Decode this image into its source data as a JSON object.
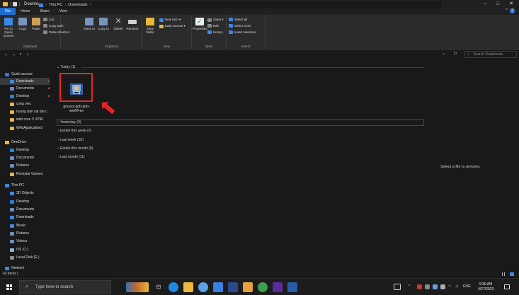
{
  "window": {
    "title": "Downloads",
    "controls": {
      "minimize": "–",
      "maximize": "□",
      "close": "✕"
    }
  },
  "ribbon_tabs": [
    "File",
    "Home",
    "Share",
    "View"
  ],
  "ribbon": {
    "clipboard": {
      "pin_to_quick_access": "Pin to Quick access",
      "copy": "Copy",
      "paste": "Paste",
      "cut": "Cut",
      "copy_path": "Copy path",
      "paste_shortcut": "Paste shortcut",
      "label": "Clipboard"
    },
    "organize": {
      "move_to": "Move to",
      "copy_to": "Copy to",
      "delete": "Delete",
      "rename": "Rename",
      "label": "Organize"
    },
    "new": {
      "new_folder": "New folder",
      "new_item": "New item ▾",
      "easy_access": "Easy access ▾",
      "label": "New"
    },
    "open": {
      "properties": "Properties",
      "open": "Open ▾",
      "edit": "Edit",
      "history": "History",
      "label": "Open"
    },
    "select": {
      "select_all": "Select all",
      "select_none": "Select none",
      "invert_selection": "Invert selection",
      "label": "Select"
    }
  },
  "address": {
    "crumb_root": "This PC",
    "crumb_current": "Downloads",
    "search_placeholder": "Search Downloads"
  },
  "nav_pane": {
    "items": [
      {
        "label": "Quick access",
        "icon": "star-icon",
        "color": "#2e7fe0"
      },
      {
        "label": "Downloads",
        "icon": "download-folder-icon",
        "color": "#3a89e6",
        "pinned": true,
        "selected": true
      },
      {
        "label": "Documents",
        "icon": "documents-icon",
        "color": "#6b8fc4",
        "pinned": true
      },
      {
        "label": "Desktop",
        "icon": "desktop-icon",
        "color": "#1e88e5",
        "pinned": true
      },
      {
        "label": "cong viec",
        "icon": "folder-icon",
        "color": "#e8b93c"
      },
      {
        "label": "huong dan cai dat c",
        "icon": "folder-icon",
        "color": "#e8b93c"
      },
      {
        "label": "intel core i7 4790",
        "icon": "folder-icon",
        "color": "#e8b93c"
      },
      {
        "label": "WebApplication1",
        "icon": "folder-icon",
        "color": "#e8b93c"
      },
      {
        "label": "OneDrive",
        "icon": "onedrive-icon",
        "color": "#e8b93c"
      },
      {
        "label": "Desktop",
        "icon": "desktop-icon",
        "color": "#1e88e5"
      },
      {
        "label": "Documents",
        "icon": "documents-icon",
        "color": "#6b8fc4"
      },
      {
        "label": "Pictures",
        "icon": "pictures-icon",
        "color": "#6b8fc4"
      },
      {
        "label": "Rockstar Games",
        "icon": "folder-icon",
        "color": "#e8b93c"
      },
      {
        "label": "This PC",
        "icon": "pc-icon",
        "color": "#3a89e6"
      },
      {
        "label": "3D Objects",
        "icon": "3d-objects-icon",
        "color": "#3a89e6"
      },
      {
        "label": "Desktop",
        "icon": "desktop-icon",
        "color": "#1e88e5"
      },
      {
        "label": "Documents",
        "icon": "documents-icon",
        "color": "#6b8fc4"
      },
      {
        "label": "Downloads",
        "icon": "download-icon",
        "color": "#3a89e6"
      },
      {
        "label": "Music",
        "icon": "music-icon",
        "color": "#3a89e6"
      },
      {
        "label": "Pictures",
        "icon": "pictures-icon",
        "color": "#6b8fc4"
      },
      {
        "label": "Videos",
        "icon": "videos-icon",
        "color": "#6b8fc4"
      },
      {
        "label": "OS (C:)",
        "icon": "drive-icon",
        "color": "#8fb3d9"
      },
      {
        "label": "Local Disk (E:)",
        "icon": "drive-icon",
        "color": "#8f8f8f"
      },
      {
        "label": "Network",
        "icon": "network-icon",
        "color": "#3a89e6"
      }
    ]
  },
  "content": {
    "groups": [
      {
        "label": "Today (1)",
        "expanded": true
      },
      {
        "label": "Yesterday (3)"
      },
      {
        "label": "Earlier this week (2)"
      },
      {
        "label": "Last week (18)"
      },
      {
        "label": "Earlier this month (8)"
      },
      {
        "label": "Last month (11)"
      }
    ],
    "file": {
      "name_line1": "gnuxxx-gcb-pnb-",
      "name_line2": "win64-en"
    },
    "preview_hint": "Select a file to preview."
  },
  "status": {
    "items_count": "43 items |"
  },
  "taskbar": {
    "search_placeholder": "Type here to search",
    "tray_lang": "ENG",
    "time": "9:30 AM",
    "date": "4/27/2023"
  },
  "colors": {
    "accent": "#1f6fd0",
    "folder": "#e8b93c",
    "highlight_red": "#e52525"
  }
}
